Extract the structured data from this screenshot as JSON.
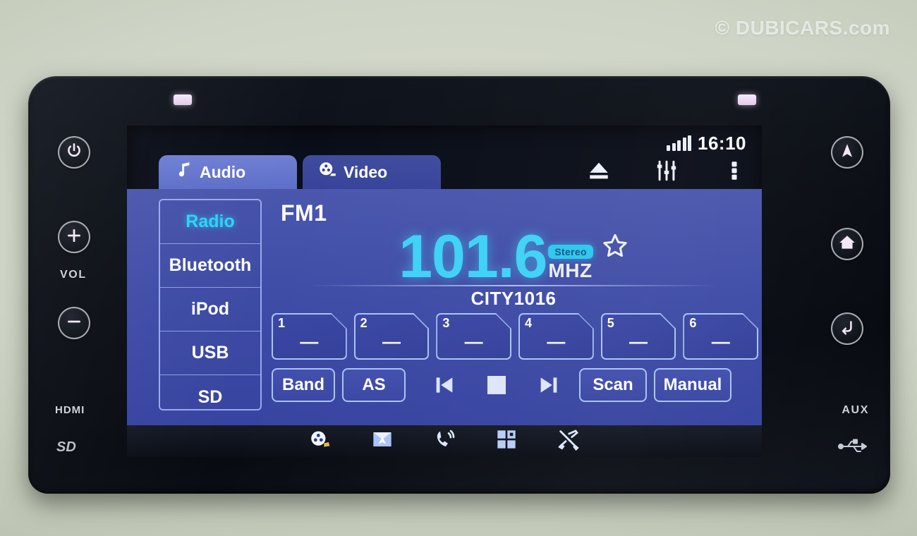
{
  "watermark": "© DUBICARS.com",
  "status": {
    "clock": "16:10",
    "signal_icon": "signal-bars-icon",
    "signal_level": 5
  },
  "tabs": [
    {
      "label": "Audio",
      "icon": "music-note-icon",
      "active": true
    },
    {
      "label": "Video",
      "icon": "film-reel-icon",
      "active": false
    }
  ],
  "top_icons": [
    {
      "name": "eject-icon"
    },
    {
      "name": "equalizer-icon"
    },
    {
      "name": "more-options-icon"
    }
  ],
  "sources": [
    {
      "label": "Radio",
      "active": true
    },
    {
      "label": "Bluetooth",
      "active": false
    },
    {
      "label": "iPod",
      "active": false
    },
    {
      "label": "USB",
      "active": false
    },
    {
      "label": "SD",
      "active": false
    }
  ],
  "radio": {
    "band": "FM1",
    "frequency": "101.6",
    "unit": "MHZ",
    "stereo_badge": "Stereo",
    "favorite_icon": "star-outline-icon",
    "station_name": "CITY1016"
  },
  "presets": [
    {
      "number": "1",
      "value": "—"
    },
    {
      "number": "2",
      "value": "—"
    },
    {
      "number": "3",
      "value": "—"
    },
    {
      "number": "4",
      "value": "—"
    },
    {
      "number": "5",
      "value": "—"
    },
    {
      "number": "6",
      "value": "—"
    }
  ],
  "controls": {
    "band_label": "Band",
    "as_label": "AS",
    "scan_label": "Scan",
    "manual_label": "Manual",
    "prev_icon": "previous-track-icon",
    "stop_icon": "stop-icon",
    "next_icon": "next-track-icon"
  },
  "dock_icons": [
    {
      "name": "media-icon"
    },
    {
      "name": "navigation-map-icon"
    },
    {
      "name": "phone-icon"
    },
    {
      "name": "apps-grid-icon"
    },
    {
      "name": "settings-tools-icon"
    }
  ],
  "hardware": {
    "power_icon": "power-icon",
    "vol_up_icon": "plus-icon",
    "vol_label": "VOL",
    "vol_down_icon": "minus-icon",
    "nav_icon": "navigation-arrow-icon",
    "home_icon": "home-icon",
    "back_icon": "back-arrow-icon",
    "hdmi_label": "HDMI",
    "sd_label": "SD",
    "aux_label": "AUX",
    "usb_icon": "usb-icon"
  },
  "colors": {
    "accent_cyan": "#3ed2f7",
    "panel_blue": "#3f4ca6",
    "tab_active": "#6f7fd4",
    "trim": "#cfd5c6"
  }
}
